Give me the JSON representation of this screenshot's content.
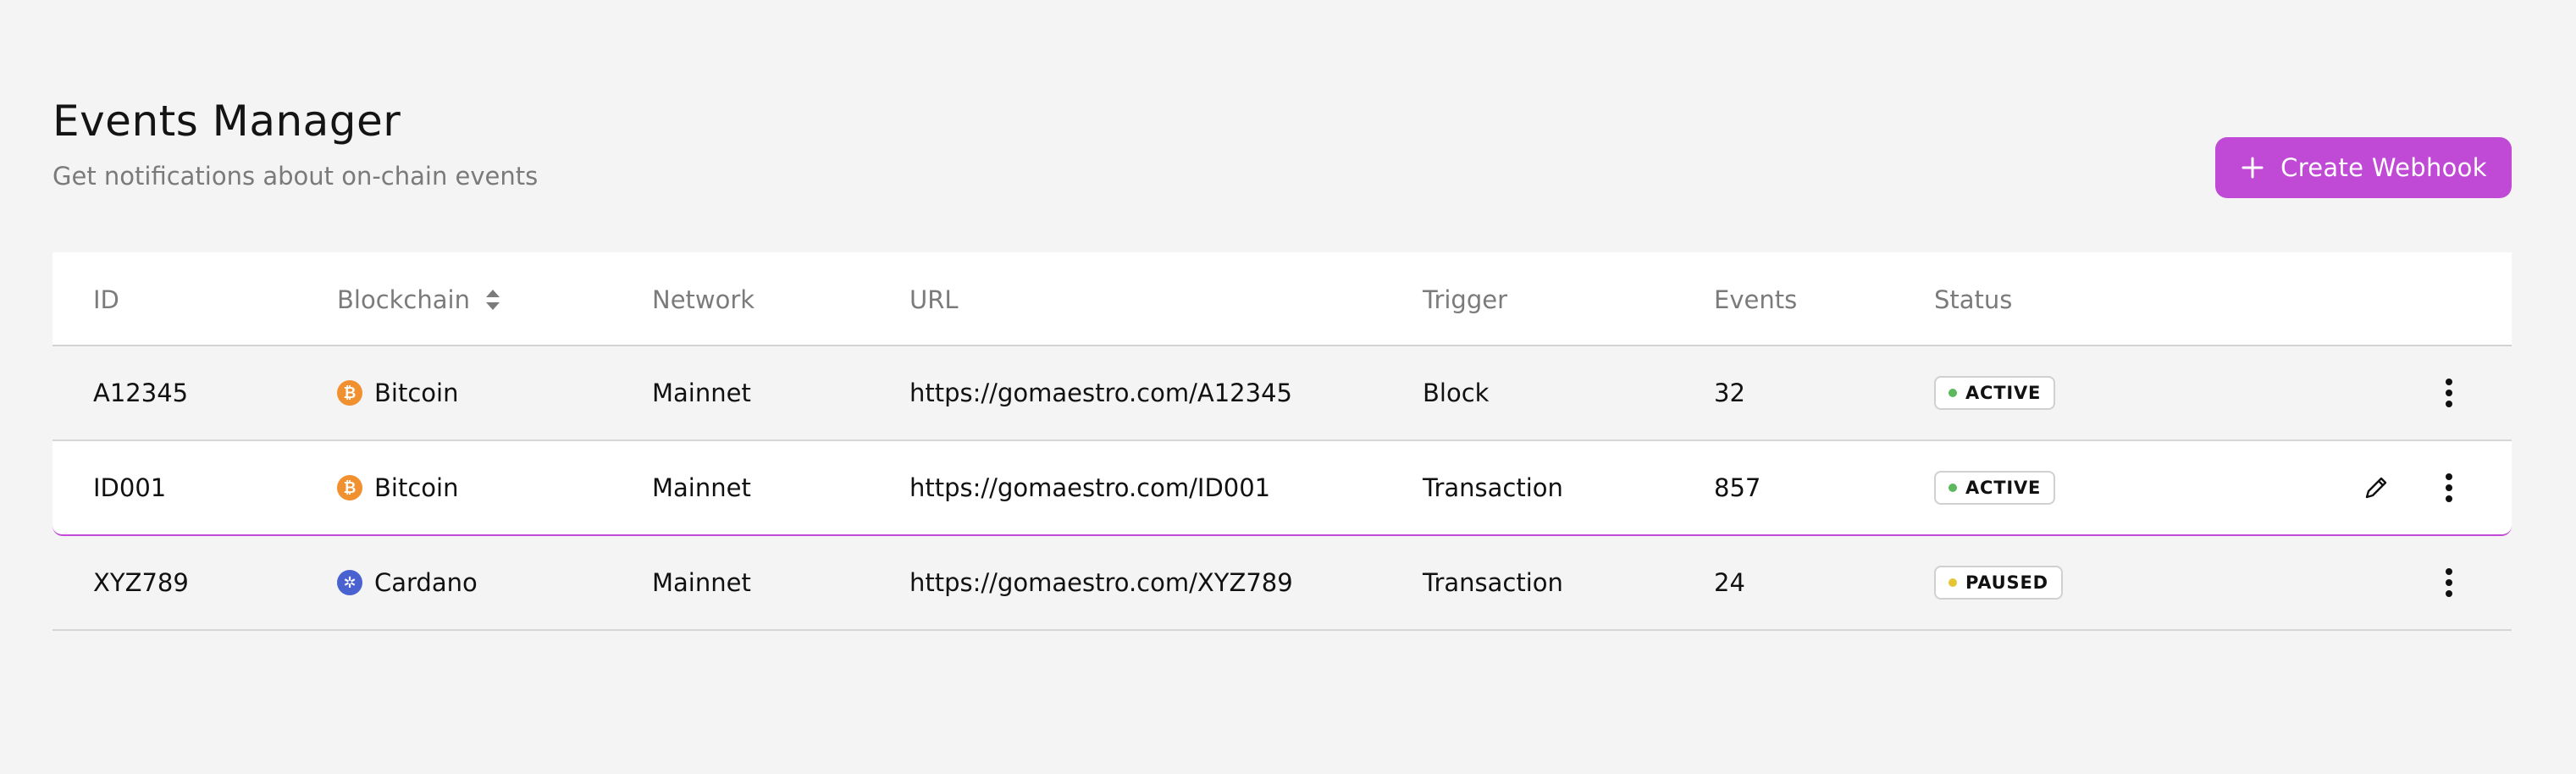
{
  "header": {
    "title": "Events Manager",
    "subtitle": "Get notifications about on-chain events"
  },
  "create_button": {
    "label": "Create Webhook",
    "icon": "plus-icon",
    "color": "#c04ad6"
  },
  "table": {
    "columns": [
      "ID",
      "Blockchain",
      "Network",
      "URL",
      "Trigger",
      "Events",
      "Status"
    ],
    "sortable_column": "Blockchain",
    "rows": [
      {
        "id": "A12345",
        "blockchain": "Bitcoin",
        "chain_icon": "bitcoin-icon",
        "network": "Mainnet",
        "url": "https://gomaestro.com/A12345",
        "trigger": "Block",
        "events": "32",
        "status": "ACTIVE",
        "status_color": "#5cb85c",
        "highlighted": false
      },
      {
        "id": "ID001",
        "blockchain": "Bitcoin",
        "chain_icon": "bitcoin-icon",
        "network": "Mainnet",
        "url": "https://gomaestro.com/ID001",
        "trigger": "Transaction",
        "events": "857",
        "status": "ACTIVE",
        "status_color": "#5cb85c",
        "highlighted": true
      },
      {
        "id": "XYZ789",
        "blockchain": "Cardano",
        "chain_icon": "cardano-icon",
        "network": "Mainnet",
        "url": "https://gomaestro.com/XYZ789",
        "trigger": "Transaction",
        "events": "24",
        "status": "PAUSED",
        "status_color": "#e6c534",
        "highlighted": false
      }
    ]
  }
}
